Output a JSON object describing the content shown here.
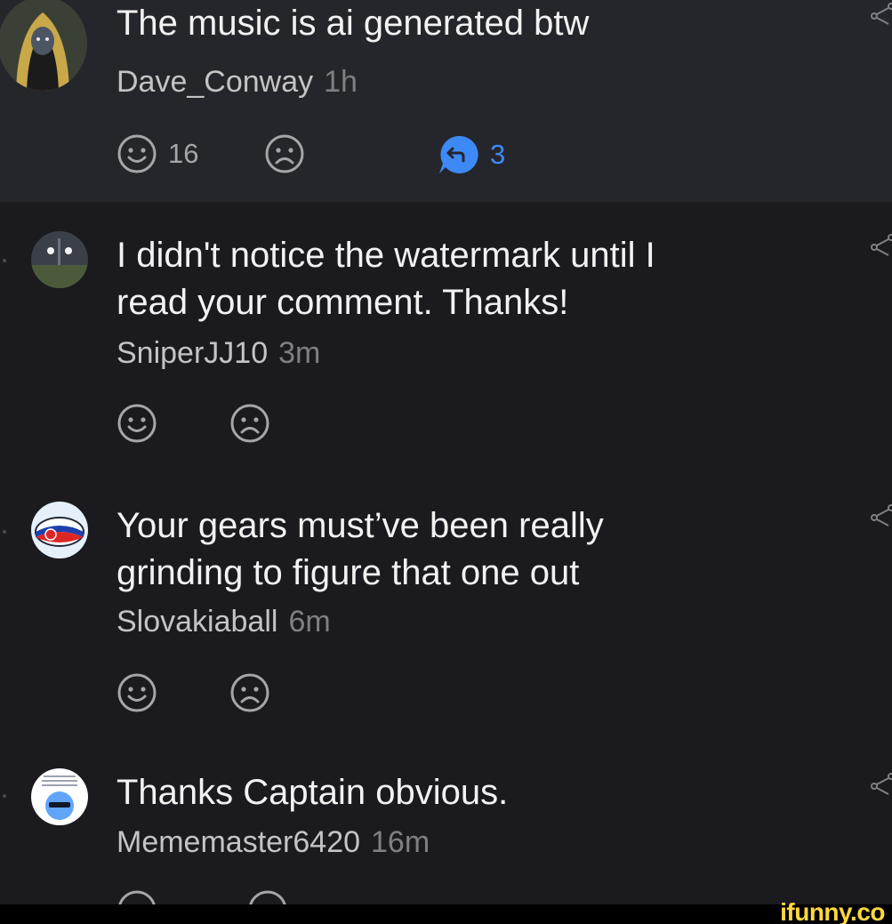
{
  "comments": [
    {
      "text_lines": [
        "The music is ai generated btw"
      ],
      "author": "Dave_Conway",
      "time": "1h",
      "likes": "16",
      "replies": "3",
      "avatar_icon": "hooded-figure-avatar"
    },
    {
      "text_lines": [
        "I didn't notice the watermark until I",
        "read your comment. Thanks!"
      ],
      "author": "SniperJJ10",
      "time": "3m",
      "avatar_icon": "night-field-avatar"
    },
    {
      "text_lines": [
        "Your gears must’ve been really",
        "grinding to figure that one out"
      ],
      "author": "Slovakiaball",
      "time": "6m",
      "avatar_icon": "slovakiaball-avatar"
    },
    {
      "text_lines": [
        "Thanks Captain obvious."
      ],
      "author": "Mememaster6420",
      "time": "16m",
      "avatar_icon": "meme-ball-avatar"
    }
  ],
  "watermark": "ifunny.co",
  "colors": {
    "background": "#1a1a1f",
    "highlight_background": "#25262b",
    "reply_accent": "#3d8af7",
    "watermark": "#ffd83d"
  }
}
